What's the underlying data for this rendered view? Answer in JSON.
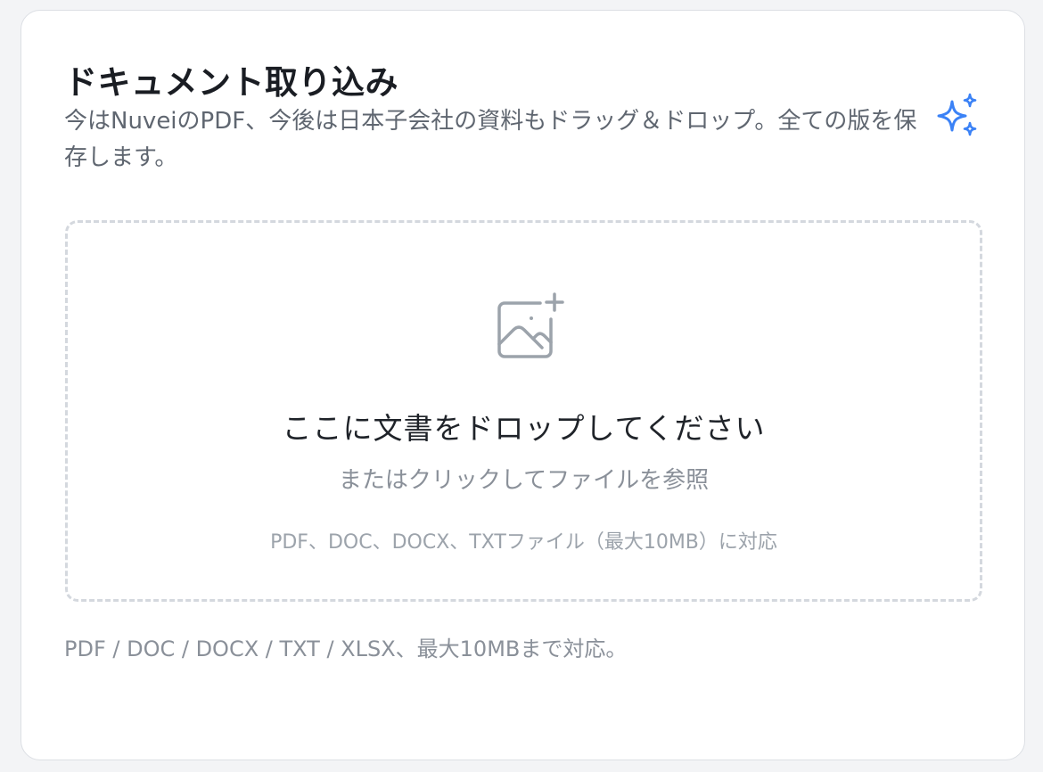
{
  "header": {
    "title": "ドキュメント取り込み",
    "description": "今はNuveiのPDF、今後は日本子会社の資料もドラッグ＆ドロップ。全ての版を保存します。",
    "sparkle_icon": "sparkle-icon",
    "accent_color": "#3b82f6"
  },
  "dropzone": {
    "icon": "image-plus-icon",
    "title": "ここに文書をドロップしてください",
    "subtitle": "またはクリックしてファイルを参照",
    "formats": "PDF、DOC、DOCX、TXTファイル（最大10MB）に対応"
  },
  "footer": {
    "note": "PDF / DOC / DOCX / TXT / XLSX、最大10MBまで対応。"
  }
}
